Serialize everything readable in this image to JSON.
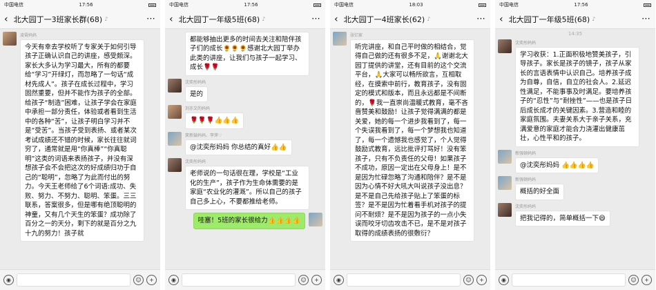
{
  "phones": [
    {
      "carrier": "中国电信",
      "time": "17:56",
      "title": "北大园丁一3班家长群(68)",
      "messages": [
        {
          "nick": "凌霄妈妈",
          "text": "今天有幸去学校听了专家关于如何引导孩子正确认识自己的讲座，感受颇深。家长大多认为学习最大，所有的都要给“学习”开绿灯，而忽略了一句话“成材先成人”。孩子在成长过程中，学习固然重要，但并不能作为孩子的全部。给孩子“制造”困难，让孩子学会在家庭中承担一部分责任，体验或者看到生活中的各种“苦”，让孩子明白学习并不是“受苦”。当孩子受到表扬、或者某次考试成绩还不错的时候，家长往往就词穷了，通常就是用“你真棒”“你真聪明”这类的词语来表扬孩子，并没有深想孩子会不会把这次的好成绩归功于自己的“聪明”，忽略了为此而付出的努力。今天王老师给了6个词语:成功、失败、努力、不努力、聪明、笨蛋。三三联系，答案很多，但是哪有绝顶聪明的神童，又有几个天生的笨蛋？成功除了百分之一的天分，剩下的就是百分之九十九的努力！孩子就"
        }
      ]
    },
    {
      "carrier": "中国电信",
      "time": "17:56",
      "title": "北大园丁一年级5班(68)",
      "messages": [
        {
          "nick": "",
          "text": "都能够抽出更多的时间去关注和陪伴孩子们的成长🌻🌻🌻感谢北大园丁举办此类的讲座，让我们与孩子一起学习、成长🌹🌹"
        },
        {
          "nick": "沈奕彤妈妈",
          "text": "是的"
        },
        {
          "nick": "刘亦文的妈妈",
          "text": "🌹🌹🌹👍👍👍"
        },
        {
          "nick": "笑新鼓妈妈、李萍♡",
          "text": "@沈奕彤妈妈 你总结的真好👍👍"
        },
        {
          "nick": "沈奕彤妈妈",
          "text": "老师说的一句话很在理，学校是“工业化的生产”，孩子作为生命体需要的是家庭“农业化的灌溉”。所以自己的孩子自己多上心，不要都推给老师。"
        },
        {
          "nick": "",
          "text": "哇塞！5班的家长很给力👍👍👍👍"
        }
      ]
    },
    {
      "carrier": "中国电信",
      "time": "18:03",
      "title": "北大园丁一4班家长(62)",
      "messages": [
        {
          "nick": "张亿家",
          "text": "听完讲座，和自己平时做的相结合，觉得自己做的还有很多不足，🙏谢谢北大园丁提供的讲堂，还有目前的这个交流平台，🙏大家可以畅所欲言，互相取经，在摸索中前行，教育孩子，没有固定的模式和版本，而且永远都是不间断的，🌹我一直崇尚温暖式教育，毫不吝啬赞美和鼓励！让孩子觉得满满的都是关爱，她的每一个进步我看到了，每一个失误我看到了，每一个梦想我也知道了，每一个遗憾我也感觉了，个人觉得鼓励式教育，远比批评打骂好！没有笨孩子，只有不负责任的父母！如果孩子不成功，原因一定出在父母身上！是不是因为忙碌忽略了沟通和陪伴？是不是因为心情不好大吼大叫说孩子没出息？是不是自己先给孩子贴上了笨蛋的标签？是不是因为忙着看手机对孩子的提问不耐烦？是不是因为孩子的一点小失误而咬牙切齿攻击不已，是不是对孩子取得的成绩表扬的很敷衍？"
        }
      ]
    },
    {
      "carrier": "中国电信",
      "time": "17:56",
      "title": "北大园丁一年级5班(68)",
      "stamp": "14:35",
      "messages": [
        {
          "nick": "沈奕彤妈妈",
          "text": "学习收获：1.正面积极地赞美孩子，引导孩子。家长是孩子的镜子，孩子从家长的言语表情中认识自己。培养孩子成为自尊，自信，自立的社会人。2.延迟性满足，不能事事及时满足。要培养孩子的“忍性”与“耐挫性”——也是孩子日后成长成才的关键因素。3.营造和睦的家庭氛围。夫妻关系大于亲子关系，充满爱意的家庭才能合力浇灌出健康茁壮，心性平和的孩子。"
        },
        {
          "nick": "新强顿妈妈",
          "text": "@沈奕彤妈妈 👍👍👍👍"
        },
        {
          "nick": "新强顿妈妈",
          "text": "概括的好全面"
        },
        {
          "nick": "沈奕彤妈妈",
          "text": "把我记得的，简单概括一下😄"
        }
      ]
    }
  ]
}
